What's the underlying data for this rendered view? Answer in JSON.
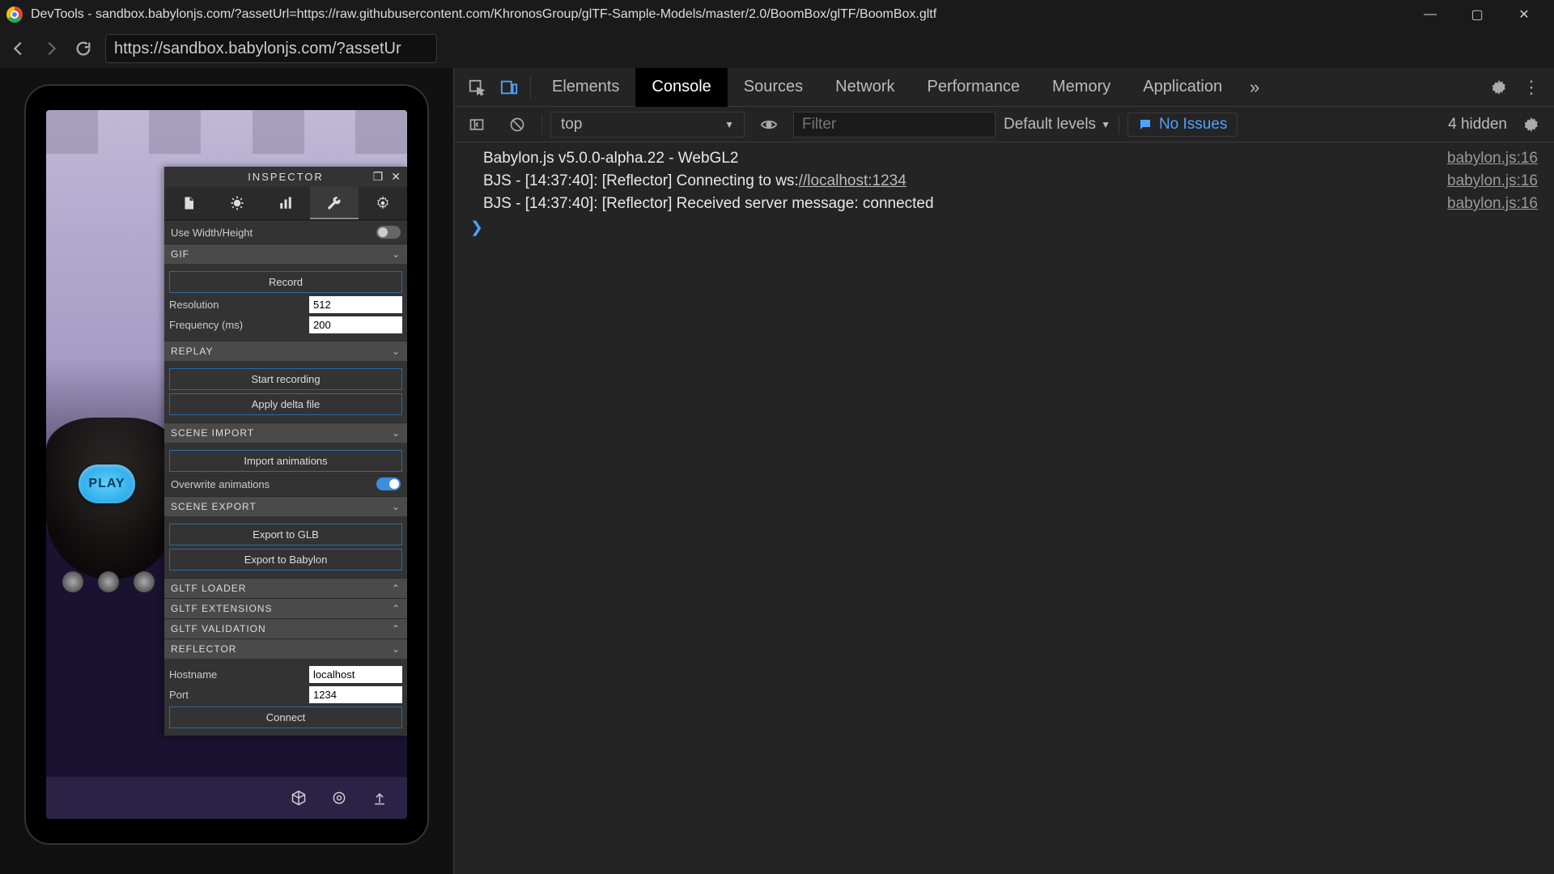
{
  "window": {
    "title": "DevTools - sandbox.babylonjs.com/?assetUrl=https://raw.githubusercontent.com/KhronosGroup/glTF-Sample-Models/master/2.0/BoomBox/glTF/BoomBox.gltf"
  },
  "nav": {
    "url": "https://sandbox.babylonjs.com/?assetUr"
  },
  "sandbox": {
    "play_label": "PLAY"
  },
  "inspector": {
    "title": "INSPECTOR",
    "use_wh": "Use Width/Height",
    "sections": {
      "gif": "GIF",
      "replay": "REPLAY",
      "scene_import": "SCENE IMPORT",
      "scene_export": "SCENE EXPORT",
      "gltf_loader": "GLTF LOADER",
      "gltf_ext": "GLTF EXTENSIONS",
      "gltf_valid": "GLTF VALIDATION",
      "reflector": "REFLECTOR"
    },
    "gif": {
      "record": "Record",
      "resolution_label": "Resolution",
      "resolution_value": "512",
      "frequency_label": "Frequency (ms)",
      "frequency_value": "200"
    },
    "replay": {
      "start": "Start recording",
      "apply": "Apply delta file"
    },
    "scene_import": {
      "import": "Import animations",
      "overwrite": "Overwrite animations"
    },
    "scene_export": {
      "glb": "Export to GLB",
      "babylon": "Export to Babylon"
    },
    "reflector": {
      "hostname_label": "Hostname",
      "hostname_value": "localhost",
      "port_label": "Port",
      "port_value": "1234",
      "connect": "Connect"
    }
  },
  "devtools": {
    "tabs": {
      "elements": "Elements",
      "console": "Console",
      "sources": "Sources",
      "network": "Network",
      "performance": "Performance",
      "memory": "Memory",
      "application": "Application"
    },
    "toolbar": {
      "context": "top",
      "filter_placeholder": "Filter",
      "levels": "Default levels",
      "issues": "No Issues",
      "hidden": "4 hidden"
    },
    "logs": [
      {
        "msg": "Babylon.js v5.0.0-alpha.22 - WebGL2",
        "src": "babylon.js:16"
      },
      {
        "msg_pre": "BJS - [14:37:40]: [Reflector] Connecting to ws:",
        "link": "//localhost:1234",
        "src": "babylon.js:16"
      },
      {
        "msg": "BJS - [14:37:40]: [Reflector] Received server message: connected",
        "src": "babylon.js:16"
      }
    ]
  }
}
